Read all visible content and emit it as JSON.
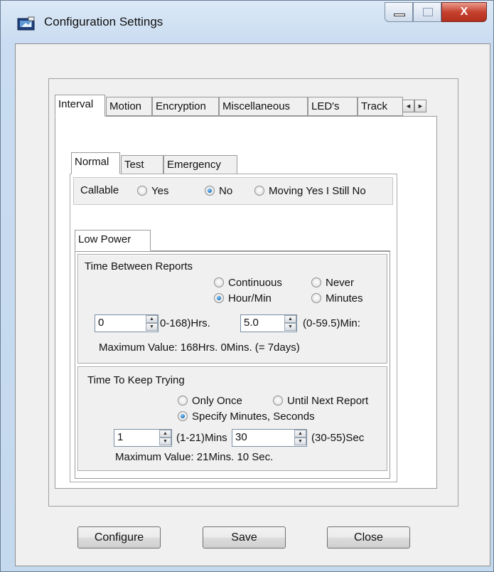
{
  "window": {
    "title": "Configuration Settings",
    "close_glyph": "X"
  },
  "main_tabs": [
    "Interval",
    "Motion",
    "Encryption",
    "Miscellaneous",
    "LED's",
    "Track"
  ],
  "sub_tabs": [
    "Normal",
    "Test",
    "Emergency"
  ],
  "callable": {
    "label": "Callable",
    "options": [
      "Yes",
      "No",
      "Moving Yes I Still No"
    ],
    "selected": "No"
  },
  "power_tab": "Low Power",
  "reports": {
    "title": "Time Between Reports",
    "options": [
      "Continuous",
      "Never",
      "Hour/Min",
      "Minutes"
    ],
    "selected": "Hour/Min",
    "hours_value": "0",
    "hours_range": "0-168)Hrs.",
    "minutes_value": "5.0",
    "minutes_range": "(0-59.5)Min:",
    "max_text": "Maximum Value: 168Hrs. 0Mins. (= 7days)"
  },
  "trying": {
    "title": "Time To Keep Trying",
    "options": [
      "Only Once",
      "Until Next Report",
      "Specify Minutes, Seconds"
    ],
    "selected": "Specify Minutes, Seconds",
    "mins_value": "1",
    "mins_range": "(1-21)Mins",
    "secs_value": "30",
    "secs_range": "(30-55)Sec",
    "max_text": "Maximum Value:  21Mins. 10 Sec."
  },
  "buttons": {
    "configure": "Configure",
    "save": "Save",
    "close": "Close"
  },
  "icons": {
    "app": "app-icon",
    "scroll_left": "◄",
    "scroll_right": "►",
    "spin_up": "▲",
    "spin_down": "▼"
  }
}
